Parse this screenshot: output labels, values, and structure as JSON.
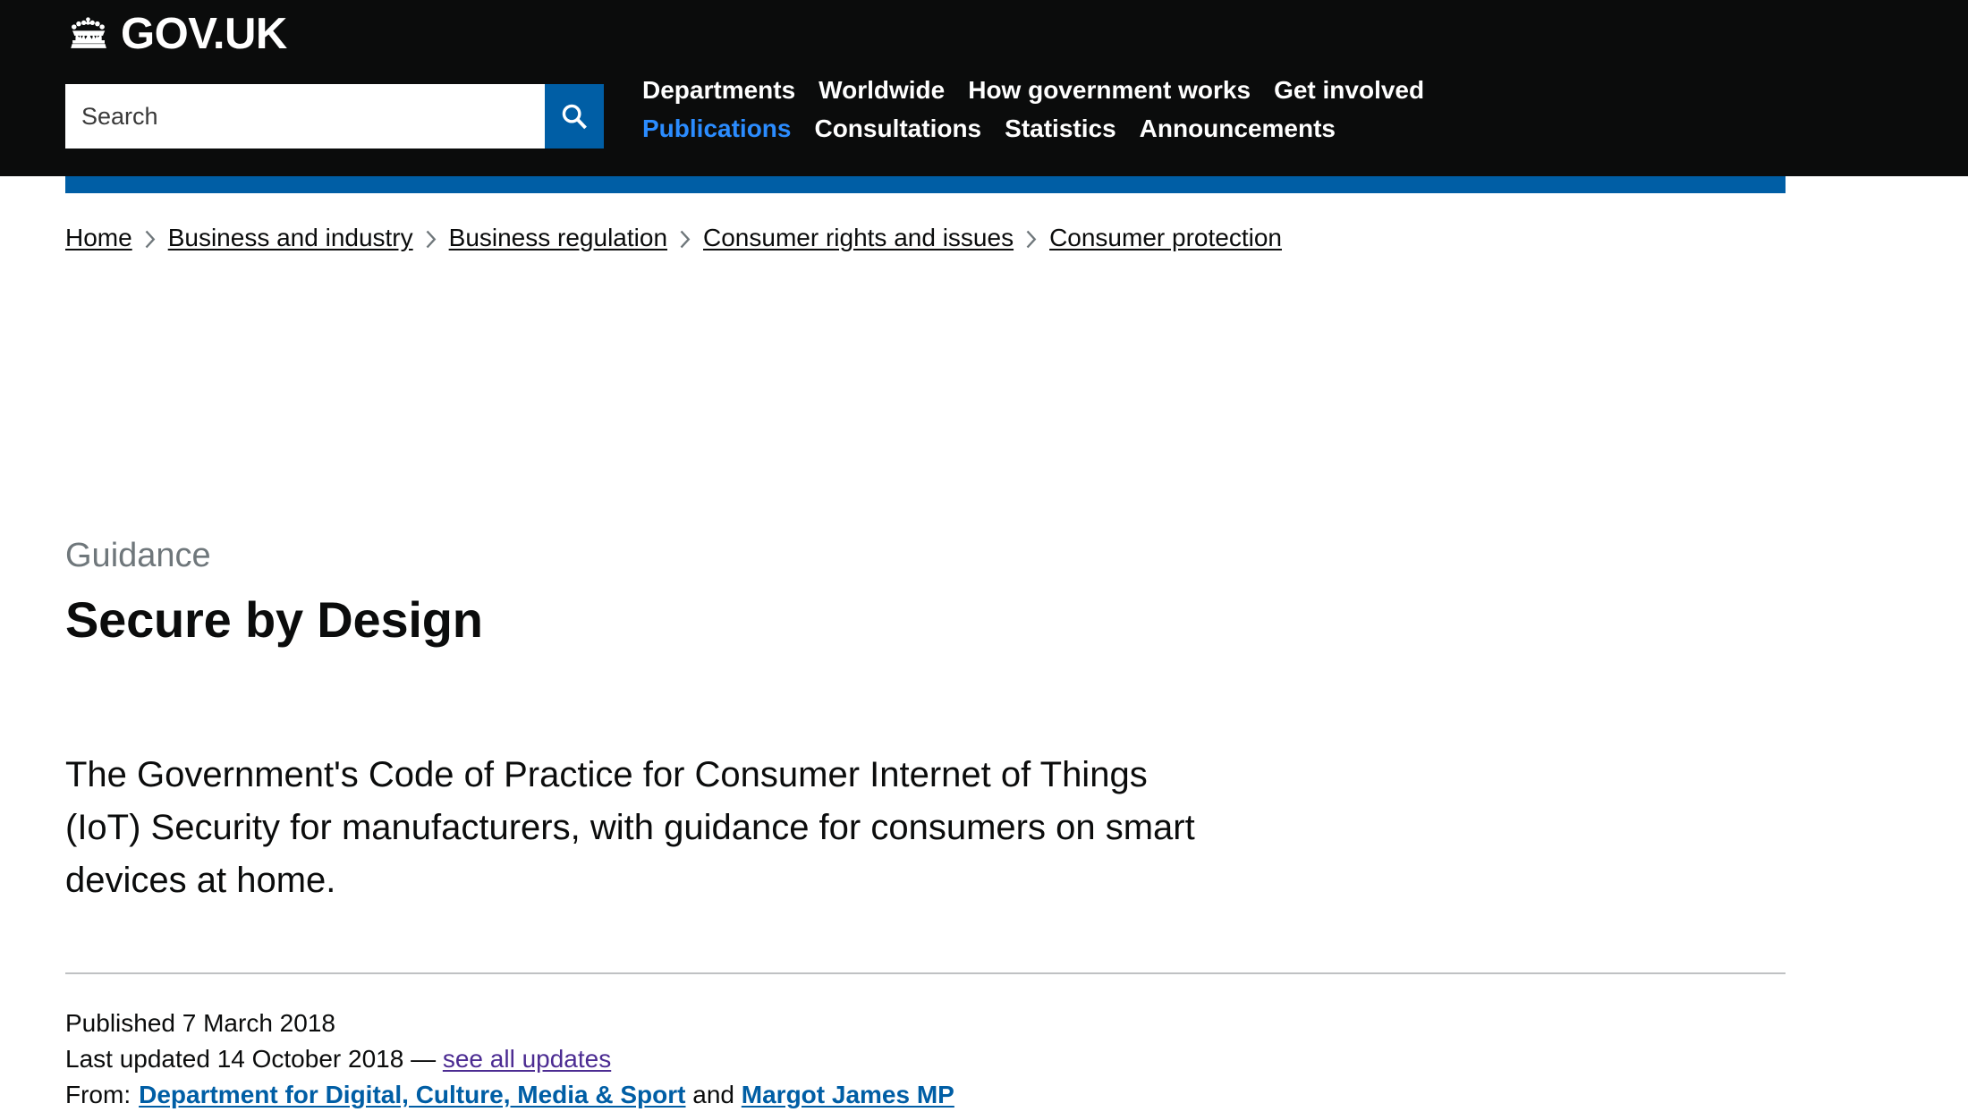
{
  "header": {
    "logo_text": "GOV.UK",
    "crown_icon": "crown-icon",
    "search": {
      "placeholder": "Search",
      "value": "",
      "button_icon": "search-icon"
    },
    "nav_row_1": [
      {
        "label": "Departments",
        "active": false
      },
      {
        "label": "Worldwide",
        "active": false
      },
      {
        "label": "How government works",
        "active": false
      },
      {
        "label": "Get involved",
        "active": false
      }
    ],
    "nav_row_2": [
      {
        "label": "Publications",
        "active": true
      },
      {
        "label": "Consultations",
        "active": false
      },
      {
        "label": "Statistics",
        "active": false
      },
      {
        "label": "Announcements",
        "active": false
      }
    ]
  },
  "breadcrumbs": [
    {
      "label": "Home"
    },
    {
      "label": "Business and industry"
    },
    {
      "label": "Business regulation"
    },
    {
      "label": "Consumer rights and issues"
    },
    {
      "label": "Consumer protection"
    }
  ],
  "main": {
    "document_type": "Guidance",
    "title": "Secure by Design",
    "summary": "The Government's Code of Practice for Consumer Internet of Things (IoT) Security for manufacturers, with guidance for consumers on smart devices at home.",
    "metadata": {
      "published": "Published 7 March 2018",
      "last_updated_prefix": "Last updated 14 October 2018 — ",
      "see_all_updates": "see all updates",
      "from_label": "From:",
      "organisation": "Department for Digital, Culture, Media & Sport",
      "conjunction": " and ",
      "person": "Margot James MP"
    }
  },
  "colors": {
    "header_black": "#0b0c0c",
    "gov_blue": "#005ea5",
    "active_nav_blue": "#2b8cff",
    "visited_link_purple": "#4c2c92",
    "muted_grey": "#6f777b",
    "divider_grey": "#bfc1c3"
  }
}
